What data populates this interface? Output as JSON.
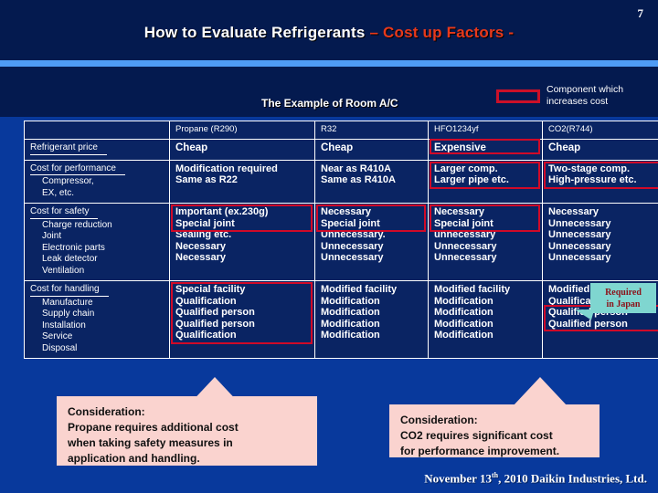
{
  "slide": {
    "number": "7",
    "title_main": "How to Evaluate Refrigerants ",
    "title_accent": "– Cost up Factors -",
    "subtitle": "The Example of Room A/C",
    "footer_pre": "November 13",
    "footer_sup": "th",
    "footer_post": ", 2010 Daikin Industries, Ltd."
  },
  "legend": {
    "text_line1": "Component which",
    "text_line2": "increases cost",
    "swatch_color": "#cc1028"
  },
  "tooltip": {
    "line1": "Required",
    "line2": "in Japan",
    "bg": "#7fd6d0",
    "fg": "#8c1119"
  },
  "table": {
    "columns": [
      "",
      "Propane (R290)",
      "R32",
      "HFO1234yf",
      "CO2(R744)"
    ],
    "rows": [
      {
        "label_head": "Refrigerant price",
        "label_subs": [],
        "cells": [
          {
            "lines": [
              "Cheap"
            ],
            "highlight": false
          },
          {
            "lines": [
              "Cheap"
            ],
            "highlight": false
          },
          {
            "lines": [
              "Expensive"
            ],
            "highlight": true
          },
          {
            "lines": [
              "Cheap"
            ],
            "highlight": false
          }
        ]
      },
      {
        "label_head": "Cost  for performance",
        "label_subs": [
          "Compressor,",
          "EX, etc."
        ],
        "cells": [
          {
            "lines": [
              "Modification required",
              "Same as R22"
            ],
            "highlight": false
          },
          {
            "lines": [
              "Near as R410A",
              "Same as R410A"
            ],
            "highlight": false
          },
          {
            "lines": [
              "Larger comp.",
              "Larger pipe etc."
            ],
            "highlight": true
          },
          {
            "lines": [
              "Two-stage comp.",
              "High-pressure etc."
            ],
            "highlight": true
          }
        ]
      },
      {
        "label_head": "Cost for safety",
        "label_subs": [
          "Charge reduction",
          "Joint",
          "Electronic parts",
          "Leak detector",
          "Ventilation"
        ],
        "cells": [
          {
            "lines": [
              "Important (ex.230g)",
              "Special joint",
              "Sealing etc.",
              "Necessary",
              "Necessary"
            ],
            "highlight": true
          },
          {
            "lines": [
              "Necessary",
              "Special joint",
              "Unnecessary.",
              "Unnecessary",
              "Unnecessary"
            ],
            "highlight": true
          },
          {
            "lines": [
              "Necessary",
              "Special joint",
              "unnecessary",
              "Unnecessary",
              "Unnecessary"
            ],
            "highlight": true
          },
          {
            "lines": [
              "Necessary",
              "Unnecessary",
              "Unnecessary",
              "Unnecessary",
              "Unnecessary"
            ],
            "highlight": false
          }
        ]
      },
      {
        "label_head": "Cost for handling",
        "label_subs": [
          "Manufacture",
          "Supply chain",
          "Installation",
          "Service",
          "Disposal"
        ],
        "cells": [
          {
            "lines": [
              "Special facility",
              "Qualification",
              "Qualified person",
              "Qualified person",
              "Qualification"
            ],
            "highlight": true
          },
          {
            "lines": [
              "Modified facility",
              "Modification",
              "Modification",
              "Modification",
              "Modification"
            ],
            "highlight": false
          },
          {
            "lines": [
              "Modified facility",
              "Modification",
              "Modification",
              "Modification",
              "Modification"
            ],
            "highlight": false
          },
          {
            "lines": [
              "Modified facility",
              "Qualification",
              "Qualified person",
              "Qualified person"
            ],
            "highlight": true
          }
        ]
      }
    ]
  },
  "callouts": [
    {
      "lines": [
        "Consideration:",
        "Propane requires additional cost",
        "when taking safety measures in",
        "application and handling."
      ]
    },
    {
      "lines": [
        "Consideration:",
        "CO2 requires significant cost",
        "for performance improvement."
      ]
    }
  ]
}
